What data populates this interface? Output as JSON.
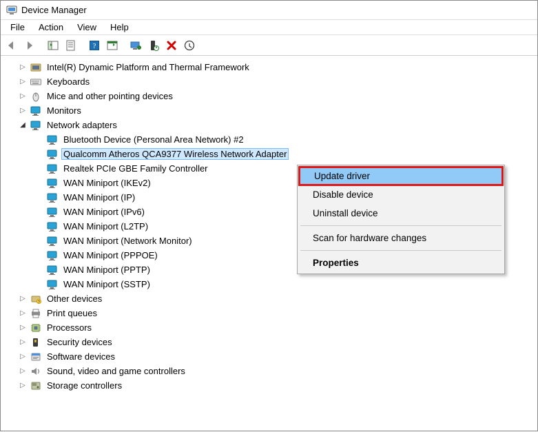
{
  "window": {
    "title": "Device Manager"
  },
  "menu": {
    "file": "File",
    "action": "Action",
    "view": "View",
    "help": "Help"
  },
  "tree": {
    "categories": [
      {
        "icon": "platform",
        "label": "Intel(R) Dynamic Platform and Thermal Framework",
        "expanded": false
      },
      {
        "icon": "keyboard",
        "label": "Keyboards",
        "expanded": false
      },
      {
        "icon": "mouse",
        "label": "Mice and other pointing devices",
        "expanded": false
      },
      {
        "icon": "monitor",
        "label": "Monitors",
        "expanded": false
      },
      {
        "icon": "network",
        "label": "Network adapters",
        "expanded": true,
        "children": [
          {
            "label": "Bluetooth Device (Personal Area Network) #2"
          },
          {
            "label": "Qualcomm Atheros QCA9377 Wireless Network Adapter",
            "selected": true
          },
          {
            "label": "Realtek PCIe GBE Family Controller"
          },
          {
            "label": "WAN Miniport (IKEv2)"
          },
          {
            "label": "WAN Miniport (IP)"
          },
          {
            "label": "WAN Miniport (IPv6)"
          },
          {
            "label": "WAN Miniport (L2TP)"
          },
          {
            "label": "WAN Miniport (Network Monitor)"
          },
          {
            "label": "WAN Miniport (PPPOE)"
          },
          {
            "label": "WAN Miniport (PPTP)"
          },
          {
            "label": "WAN Miniport (SSTP)"
          }
        ]
      },
      {
        "icon": "other",
        "label": "Other devices",
        "expanded": false
      },
      {
        "icon": "printer",
        "label": "Print queues",
        "expanded": false
      },
      {
        "icon": "cpu",
        "label": "Processors",
        "expanded": false
      },
      {
        "icon": "security",
        "label": "Security devices",
        "expanded": false
      },
      {
        "icon": "software",
        "label": "Software devices",
        "expanded": false
      },
      {
        "icon": "audio",
        "label": "Sound, video and game controllers",
        "expanded": false
      },
      {
        "icon": "storage",
        "label": "Storage controllers",
        "expanded": false
      }
    ]
  },
  "context_menu": {
    "update": "Update driver",
    "disable": "Disable device",
    "uninstall": "Uninstall device",
    "scan": "Scan for hardware changes",
    "properties": "Properties"
  }
}
